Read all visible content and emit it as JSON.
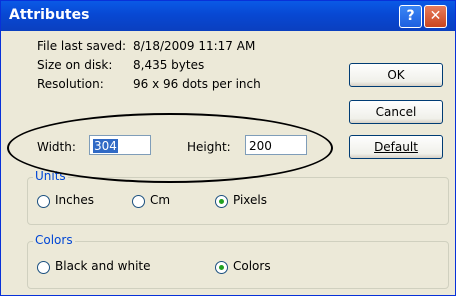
{
  "dialog": {
    "title": "Attributes",
    "help_glyph": "?",
    "close_glyph": "✕"
  },
  "info": {
    "last_saved_label": "File last saved:",
    "last_saved_value": "8/18/2009 11:17 AM",
    "size_label": "Size on disk:",
    "size_value": "8,435 bytes",
    "resolution_label": "Resolution:",
    "resolution_value": "96 x 96 dots per inch"
  },
  "buttons": {
    "ok": "OK",
    "cancel": "Cancel",
    "default": "Default"
  },
  "dimensions": {
    "width_label": "Width:",
    "width_value": "304",
    "height_label": "Height:",
    "height_value": "200"
  },
  "units": {
    "legend": "Units",
    "options": [
      "Inches",
      "Cm",
      "Pixels"
    ],
    "selected": "Pixels"
  },
  "colors": {
    "legend": "Colors",
    "options": [
      "Black and white",
      "Colors"
    ],
    "selected": "Colors"
  },
  "theme": {
    "titlebar": "#0848d3",
    "dialog_bg": "#ece9d8",
    "group_label": "#0046d5",
    "radio_dot": "#21a121"
  }
}
